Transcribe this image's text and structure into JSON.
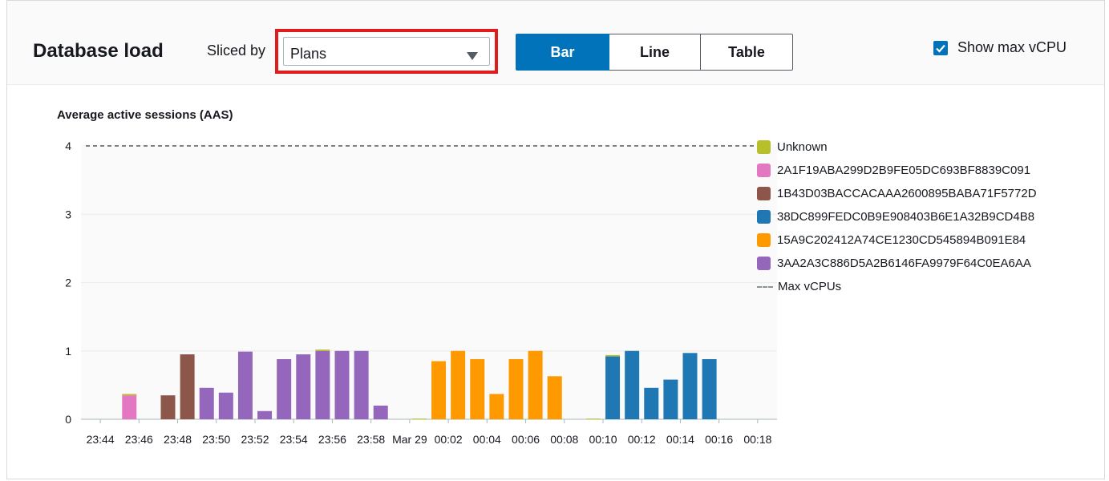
{
  "header": {
    "title": "Database load",
    "sliced_by_label": "Sliced by",
    "sliced_by_value": "Plans",
    "view_modes": [
      "Bar",
      "Line",
      "Table"
    ],
    "active_view": "Bar",
    "show_max_vcpu_label": "Show max vCPU",
    "show_max_vcpu_checked": true
  },
  "colors": {
    "accent": "#0073bb",
    "highlight_border": "#e01c1c"
  },
  "chart_data": {
    "type": "bar",
    "stacked": true,
    "title": "Average active sessions (AAS)",
    "ylabel": "",
    "xlabel": "",
    "ylim": [
      0,
      4
    ],
    "yticks": [
      0,
      1,
      2,
      3,
      4
    ],
    "xtick_labels": [
      "23:44",
      "23:46",
      "23:48",
      "23:50",
      "23:52",
      "23:54",
      "23:56",
      "23:58",
      "Mar 29",
      "00:02",
      "00:04",
      "00:06",
      "00:08",
      "00:10",
      "00:12",
      "00:14",
      "00:16",
      "00:18"
    ],
    "grid": true,
    "legend_position": "right",
    "max_vcpu": 4,
    "series": [
      {
        "name": "Unknown",
        "color": "#b7bf2a"
      },
      {
        "name": "2A1F19ABA299D2B9FE05DC693BF8839C091",
        "color": "#e377c2"
      },
      {
        "name": "1B43D03BACCACAAA2600895BABA71F5772D",
        "color": "#8c564b"
      },
      {
        "name": "38DC899FEDC0B9E908403B6E1A32B9CD4B8",
        "color": "#1f77b4"
      },
      {
        "name": "15A9C202412A74CE1230CD545894B091E84",
        "color": "#ff9900"
      },
      {
        "name": "3AA2A3C886D5A2B6146FA9979F64C0EA6AA",
        "color": "#9467bd"
      }
    ],
    "max_line_label": "Max vCPUs",
    "bars": [
      {
        "x_slot": 2,
        "segments": [
          {
            "series": "2A1F19ABA299D2B9FE05DC693BF8839C091",
            "value": 0.35
          },
          {
            "series": "Unknown",
            "value": 0.02
          }
        ]
      },
      {
        "x_slot": 4,
        "segments": [
          {
            "series": "1B43D03BACCACAAA2600895BABA71F5772D",
            "value": 0.35
          }
        ]
      },
      {
        "x_slot": 5,
        "segments": [
          {
            "series": "1B43D03BACCACAAA2600895BABA71F5772D",
            "value": 0.95
          }
        ]
      },
      {
        "x_slot": 6,
        "segments": [
          {
            "series": "3AA2A3C886D5A2B6146FA9979F64C0EA6AA",
            "value": 0.46
          }
        ]
      },
      {
        "x_slot": 7,
        "segments": [
          {
            "series": "3AA2A3C886D5A2B6146FA9979F64C0EA6AA",
            "value": 0.39
          }
        ]
      },
      {
        "x_slot": 8,
        "segments": [
          {
            "series": "3AA2A3C886D5A2B6146FA9979F64C0EA6AA",
            "value": 0.99
          }
        ]
      },
      {
        "x_slot": 9,
        "segments": [
          {
            "series": "3AA2A3C886D5A2B6146FA9979F64C0EA6AA",
            "value": 0.12
          }
        ]
      },
      {
        "x_slot": 10,
        "segments": [
          {
            "series": "3AA2A3C886D5A2B6146FA9979F64C0EA6AA",
            "value": 0.88
          }
        ]
      },
      {
        "x_slot": 11,
        "segments": [
          {
            "series": "3AA2A3C886D5A2B6146FA9979F64C0EA6AA",
            "value": 0.95
          }
        ]
      },
      {
        "x_slot": 12,
        "segments": [
          {
            "series": "3AA2A3C886D5A2B6146FA9979F64C0EA6AA",
            "value": 1.0
          },
          {
            "series": "Unknown",
            "value": 0.02
          }
        ]
      },
      {
        "x_slot": 13,
        "segments": [
          {
            "series": "3AA2A3C886D5A2B6146FA9979F64C0EA6AA",
            "value": 1.0
          }
        ]
      },
      {
        "x_slot": 14,
        "segments": [
          {
            "series": "3AA2A3C886D5A2B6146FA9979F64C0EA6AA",
            "value": 1.0
          }
        ]
      },
      {
        "x_slot": 15,
        "segments": [
          {
            "series": "3AA2A3C886D5A2B6146FA9979F64C0EA6AA",
            "value": 0.2
          }
        ]
      },
      {
        "x_slot": 17,
        "segments": [
          {
            "series": "Unknown",
            "value": 0.01
          }
        ]
      },
      {
        "x_slot": 18,
        "segments": [
          {
            "series": "15A9C202412A74CE1230CD545894B091E84",
            "value": 0.85
          }
        ]
      },
      {
        "x_slot": 19,
        "segments": [
          {
            "series": "15A9C202412A74CE1230CD545894B091E84",
            "value": 1.0
          }
        ]
      },
      {
        "x_slot": 20,
        "segments": [
          {
            "series": "15A9C202412A74CE1230CD545894B091E84",
            "value": 0.88
          }
        ]
      },
      {
        "x_slot": 21,
        "segments": [
          {
            "series": "15A9C202412A74CE1230CD545894B091E84",
            "value": 0.37
          }
        ]
      },
      {
        "x_slot": 22,
        "segments": [
          {
            "series": "15A9C202412A74CE1230CD545894B091E84",
            "value": 0.88
          }
        ]
      },
      {
        "x_slot": 23,
        "segments": [
          {
            "series": "15A9C202412A74CE1230CD545894B091E84",
            "value": 1.0
          }
        ]
      },
      {
        "x_slot": 24,
        "segments": [
          {
            "series": "15A9C202412A74CE1230CD545894B091E84",
            "value": 0.63
          }
        ]
      },
      {
        "x_slot": 26,
        "segments": [
          {
            "series": "Unknown",
            "value": 0.01
          }
        ]
      },
      {
        "x_slot": 27,
        "segments": [
          {
            "series": "38DC899FEDC0B9E908403B6E1A32B9CD4B8",
            "value": 0.92
          },
          {
            "series": "Unknown",
            "value": 0.02
          }
        ]
      },
      {
        "x_slot": 28,
        "segments": [
          {
            "series": "38DC899FEDC0B9E908403B6E1A32B9CD4B8",
            "value": 1.0
          }
        ]
      },
      {
        "x_slot": 29,
        "segments": [
          {
            "series": "38DC899FEDC0B9E908403B6E1A32B9CD4B8",
            "value": 0.46
          }
        ]
      },
      {
        "x_slot": 30,
        "segments": [
          {
            "series": "38DC899FEDC0B9E908403B6E1A32B9CD4B8",
            "value": 0.58
          }
        ]
      },
      {
        "x_slot": 31,
        "segments": [
          {
            "series": "38DC899FEDC0B9E908403B6E1A32B9CD4B8",
            "value": 0.97
          }
        ]
      },
      {
        "x_slot": 32,
        "segments": [
          {
            "series": "38DC899FEDC0B9E908403B6E1A32B9CD4B8",
            "value": 0.88
          }
        ]
      }
    ]
  }
}
